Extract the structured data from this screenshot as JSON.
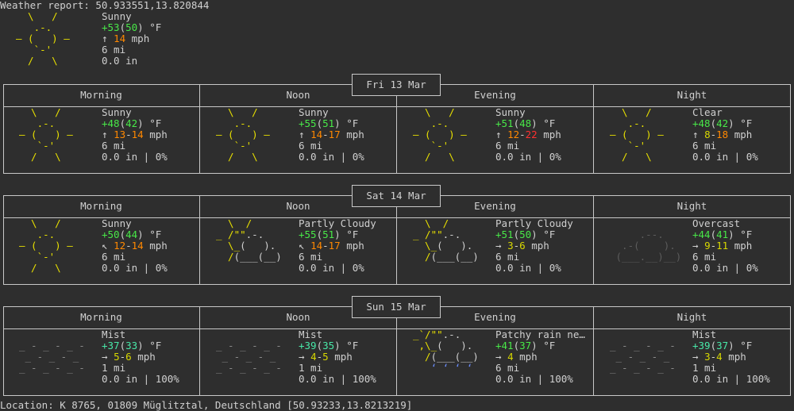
{
  "header": {
    "title": "Weather report: 50.933551,13.820844"
  },
  "current": {
    "condition": "Sunny",
    "temp_prefix": "+53",
    "temp_feels": "50",
    "temp_unit": "°F",
    "wind_arrow": "↑",
    "wind_speed": "14",
    "wind_unit": "mph",
    "visibility": "6 mi",
    "precip": "0.0 in",
    "icon": "sun-icon"
  },
  "days": [
    {
      "label": "Fri 13 Mar",
      "periods": [
        {
          "title": "Morning",
          "condition": "Sunny",
          "temp": "+48",
          "feels": "42",
          "unit": "°F",
          "wind_arrow": "↑",
          "wind_a": "13",
          "wind_b": "14",
          "wind_unit": "mph",
          "visibility": "6 mi",
          "precip": "0.0 in | 0%",
          "icon": "sun-icon"
        },
        {
          "title": "Noon",
          "condition": "Sunny",
          "temp": "+55",
          "feels": "51",
          "unit": "°F",
          "wind_arrow": "↑",
          "wind_a": "14",
          "wind_b": "17",
          "wind_unit": "mph",
          "visibility": "6 mi",
          "precip": "0.0 in | 0%",
          "icon": "sun-icon"
        },
        {
          "title": "Evening",
          "condition": "Sunny",
          "temp": "+51",
          "feels": "48",
          "unit": "°F",
          "wind_arrow": "↑",
          "wind_a": "12",
          "wind_b": "22",
          "wind_unit": "mph",
          "visibility": "6 mi",
          "precip": "0.0 in | 0%",
          "icon": "sun-icon"
        },
        {
          "title": "Night",
          "condition": "Clear",
          "temp": "+48",
          "feels": "42",
          "unit": "°F",
          "wind_arrow": "↑",
          "wind_a": "8",
          "wind_b": "18",
          "wind_unit": "mph",
          "visibility": "6 mi",
          "precip": "0.0 in | 0%",
          "icon": "sun-icon"
        }
      ]
    },
    {
      "label": "Sat 14 Mar",
      "periods": [
        {
          "title": "Morning",
          "condition": "Sunny",
          "temp": "+50",
          "feels": "44",
          "unit": "°F",
          "wind_arrow": "↖",
          "wind_a": "12",
          "wind_b": "14",
          "wind_unit": "mph",
          "visibility": "6 mi",
          "precip": "0.0 in | 0%",
          "icon": "sun-icon"
        },
        {
          "title": "Noon",
          "condition": "Partly Cloudy",
          "temp": "+55",
          "feels": "51",
          "unit": "°F",
          "wind_arrow": "↖",
          "wind_a": "14",
          "wind_b": "17",
          "wind_unit": "mph",
          "visibility": "6 mi",
          "precip": "0.0 in | 0%",
          "icon": "partly-cloudy-icon"
        },
        {
          "title": "Evening",
          "condition": "Partly Cloudy",
          "temp": "+51",
          "feels": "50",
          "unit": "°F",
          "wind_arrow": "→",
          "wind_a": "3",
          "wind_b": "6",
          "wind_unit": "mph",
          "visibility": "6 mi",
          "precip": "0.0 in | 0%",
          "icon": "partly-cloudy-icon"
        },
        {
          "title": "Night",
          "condition": "Overcast",
          "temp": "+44",
          "feels": "41",
          "unit": "°F",
          "wind_arrow": "→",
          "wind_a": "9",
          "wind_b": "11",
          "wind_unit": "mph",
          "visibility": "6 mi",
          "precip": "0.0 in | 0%",
          "icon": "overcast-icon"
        }
      ]
    },
    {
      "label": "Sun 15 Mar",
      "periods": [
        {
          "title": "Morning",
          "condition": "Mist",
          "temp": "+37",
          "feels": "33",
          "unit": "°F",
          "wind_arrow": "→",
          "wind_a": "5",
          "wind_b": "6",
          "wind_unit": "mph",
          "visibility": "1 mi",
          "precip": "0.0 in | 100%",
          "icon": "mist-icon"
        },
        {
          "title": "Noon",
          "condition": "Mist",
          "temp": "+39",
          "feels": "35",
          "unit": "°F",
          "wind_arrow": "→",
          "wind_a": "4",
          "wind_b": "5",
          "wind_unit": "mph",
          "visibility": "1 mi",
          "precip": "0.0 in | 100%",
          "icon": "mist-icon"
        },
        {
          "title": "Evening",
          "condition": "Patchy rain ne…",
          "temp": "+41",
          "feels": "37",
          "unit": "°F",
          "wind_arrow": "→",
          "wind_a": "4",
          "wind_b": "",
          "wind_unit": "mph",
          "visibility": "6 mi",
          "precip": "0.0 in | 100%",
          "icon": "patchy-rain-icon"
        },
        {
          "title": "Night",
          "condition": "Mist",
          "temp": "+39",
          "feels": "37",
          "unit": "°F",
          "wind_arrow": "→",
          "wind_a": "3",
          "wind_b": "4",
          "wind_unit": "mph",
          "visibility": "1 mi",
          "precip": "0.0 in | 100%",
          "icon": "mist-icon"
        }
      ]
    }
  ],
  "footer": {
    "location": "Location: K 8765, 01809 Müglitztal, Deutschland [50.93233,13.8213219]"
  },
  "colors": {
    "background": "#2e2e2e",
    "text": "#d0d0d0",
    "sun": "#e8e000",
    "temp_green": "#48e848",
    "temp_teal": "#48e8a8",
    "wind_orange": "#ff8800",
    "wind_red": "#ff3030",
    "wind_yellow": "#d8d800",
    "cloud_gray": "#8a8a8a",
    "overcast_gray": "#5c5c5c",
    "rain_blue": "#6a8cff",
    "border": "#c8c8c8"
  }
}
